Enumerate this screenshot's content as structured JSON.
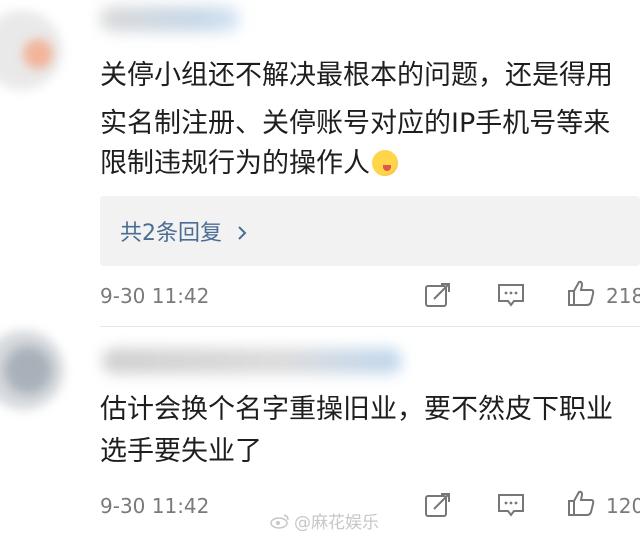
{
  "comments": [
    {
      "text_lines": [
        "关停小组还不解决最根本的问题，还是得用",
        "实名制注册、关停账号对应的IP手机号等来",
        "限制违规行为的操作人"
      ],
      "reply_label": "共2条回复",
      "time": "9-30 11:42",
      "like_count": "218"
    },
    {
      "text_lines": [
        "估计会换个名字重操旧业，要不然皮下职业",
        "选手要失业了"
      ],
      "time": "9-30 11:42",
      "like_count": "120"
    }
  ],
  "watermark": {
    "text": "@麻花娱乐",
    "icon": "weibo-icon"
  },
  "icons": {
    "repost": "repost-icon",
    "comment": "comment-icon",
    "like": "thumbs-up-icon",
    "reply_chevron": "chevron-right-icon",
    "emoji": "yummy-face-emoji"
  },
  "colors": {
    "link_blue": "#4a6d93",
    "meta_gray": "#7a7a7a"
  }
}
